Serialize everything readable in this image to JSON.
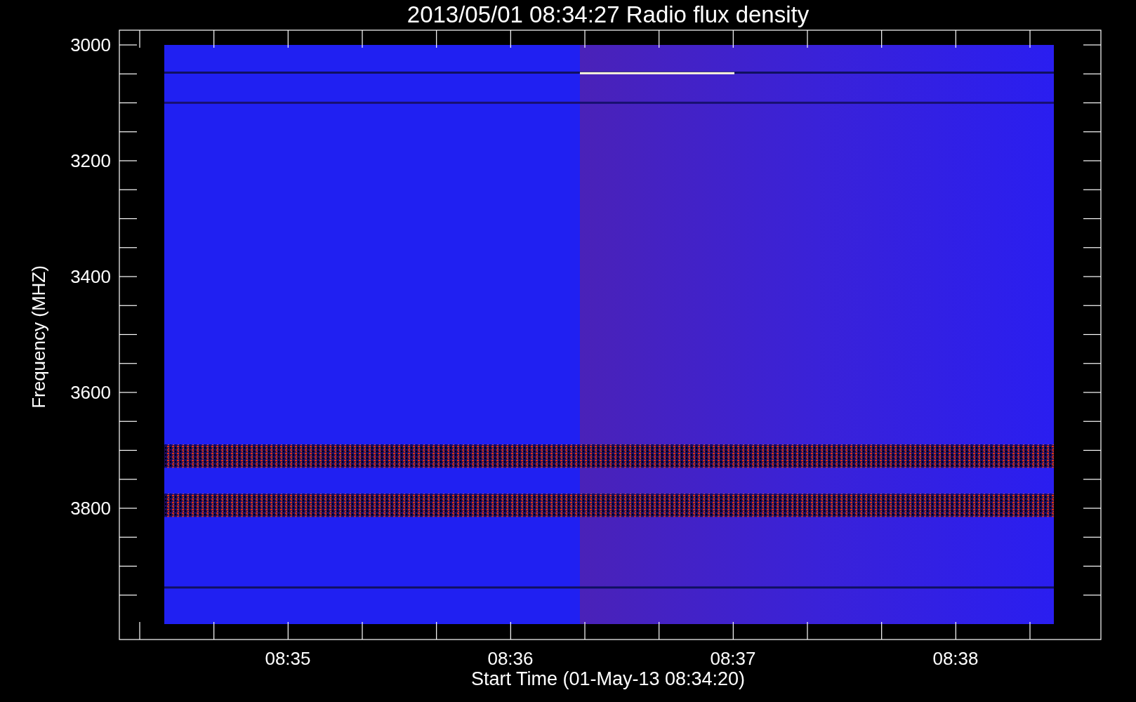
{
  "title": "2013/05/01 08:34:27 Radio flux density",
  "y_axis": {
    "label": "Frequency (MHZ)",
    "ticks": [
      "3000",
      "3200",
      "3400",
      "3600",
      "3800"
    ]
  },
  "x_axis": {
    "label": "Start Time (01-May-13 08:34:20)",
    "ticks": [
      "08:35",
      "08:36",
      "08:37",
      "08:38"
    ]
  }
}
